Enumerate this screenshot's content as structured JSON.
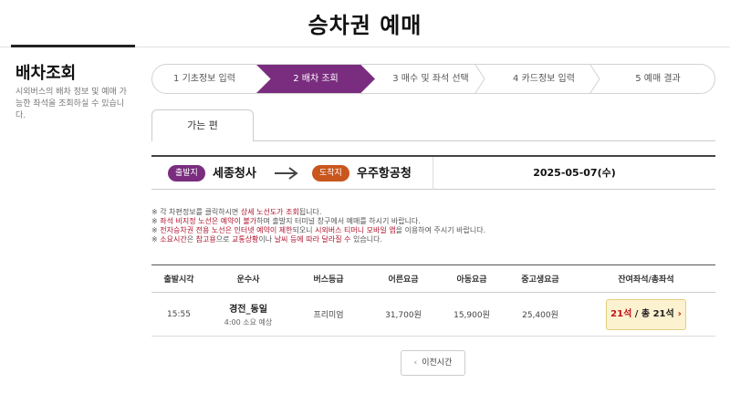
{
  "header": {
    "title": "승차권 예매"
  },
  "sidebar": {
    "title": "배차조회",
    "description": "시외버스의 배차 정보 및 예매 가능한 좌석을 조회하실 수 있습니다."
  },
  "steps": [
    {
      "label": "1 기초정보 입력"
    },
    {
      "label": "2 배차 조회"
    },
    {
      "label": "3 매수 및 좌석 선택"
    },
    {
      "label": "4 카드정보 입력"
    },
    {
      "label": "5 예매 결과"
    }
  ],
  "active_step": 2,
  "tabs": {
    "outbound": "가는 편"
  },
  "route": {
    "departure_badge": "출발지",
    "departure": "세종청사",
    "arrival_badge": "도착지",
    "arrival": "우주항공청",
    "date": "2025-05-07(수)"
  },
  "notes": {
    "n1_a": "※ 각 차편정보를 클릭하시면 ",
    "n1_b": "상세 노선도가 조회",
    "n1_c": "됩니다.",
    "n2_a": "※ ",
    "n2_b": "좌석 비지정 노선은 예약이 불가",
    "n2_c": "하며 출발지 터미널 창구에서 예매를 하시기 바랍니다.",
    "n3_a": "※ ",
    "n3_b": "전자승차권 전용 노선은 인터넷 예약이 제한",
    "n3_c": "되오니 ",
    "n3_d": "시외버스 티머니 모바일 앱",
    "n3_e": "을 이용하여 주시기 바랍니다.",
    "n4_a": "※ ",
    "n4_b": "소요시간",
    "n4_c": "은 ",
    "n4_d": "참고용",
    "n4_e": "으로 ",
    "n4_f": "교통상황",
    "n4_g": "이나 ",
    "n4_h": "날씨 등에 따라 달라질 수",
    "n4_i": " 있습니다."
  },
  "table": {
    "headers": [
      "출발시각",
      "운수사",
      "버스등급",
      "어른요금",
      "아동요금",
      "중고생요금",
      "잔여좌석/총좌석"
    ],
    "rows": [
      {
        "time": "15:55",
        "company": "경전_동일",
        "duration": "4:00 소요 예상",
        "grade": "프리미엄",
        "adult": "31,700원",
        "child": "15,900원",
        "student": "25,400원",
        "seats_left": "21석",
        "seats_total": " / 총 21석"
      }
    ]
  },
  "prev_button": "이전시간",
  "colors": {
    "primary": "#7a2d7f",
    "arrival": "#c9561d",
    "highlight": "#b0132e",
    "seat_bg": "#fcf2cf"
  }
}
